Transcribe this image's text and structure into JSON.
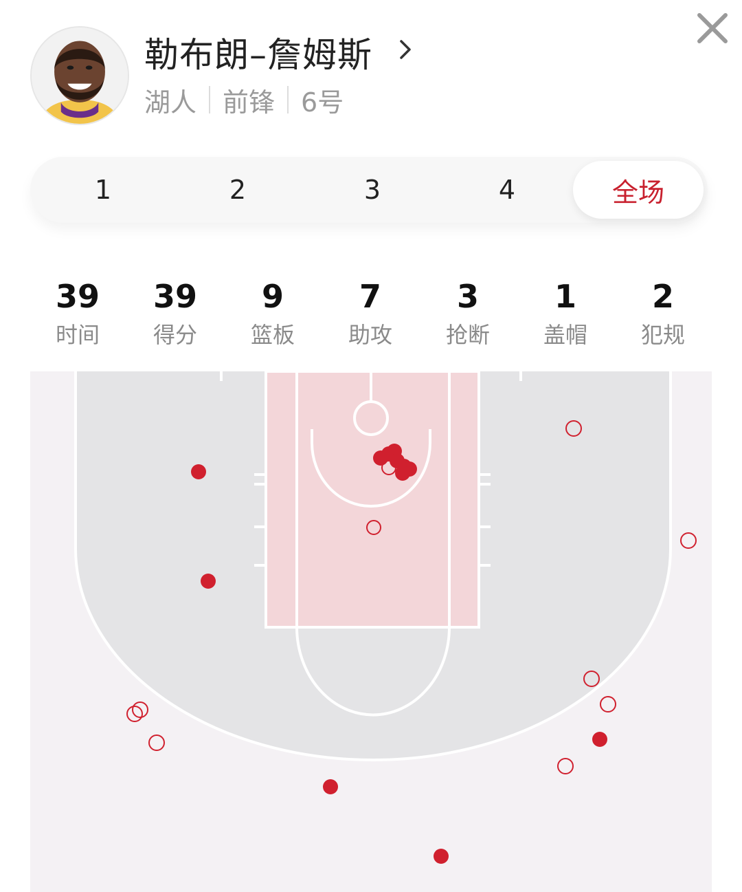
{
  "player": {
    "name": "勒布朗–詹姆斯",
    "team": "湖人",
    "position": "前锋",
    "number": "6号",
    "avatar_icon": "player-avatar-icon"
  },
  "tabs": [
    {
      "label": "1",
      "active": false
    },
    {
      "label": "2",
      "active": false
    },
    {
      "label": "3",
      "active": false
    },
    {
      "label": "4",
      "active": false
    },
    {
      "label": "全场",
      "active": true
    }
  ],
  "stats": [
    {
      "value": "39",
      "label": "时间"
    },
    {
      "value": "39",
      "label": "得分"
    },
    {
      "value": "9",
      "label": "篮板"
    },
    {
      "value": "7",
      "label": "助攻"
    },
    {
      "value": "3",
      "label": "抢断"
    },
    {
      "value": "1",
      "label": "盖帽"
    },
    {
      "value": "2",
      "label": "犯规"
    }
  ],
  "colors": {
    "accent": "#c8202e",
    "court_floor": "#f4f1f4",
    "court_three_zone": "#e4e4e6",
    "paint": "#f3d6d9",
    "made_shot": "#d0202e",
    "missed_shot": "#d0202e"
  },
  "shot_chart": {
    "legend": {
      "made": "filled-dot",
      "missed": "hollow-ring"
    }
  }
}
